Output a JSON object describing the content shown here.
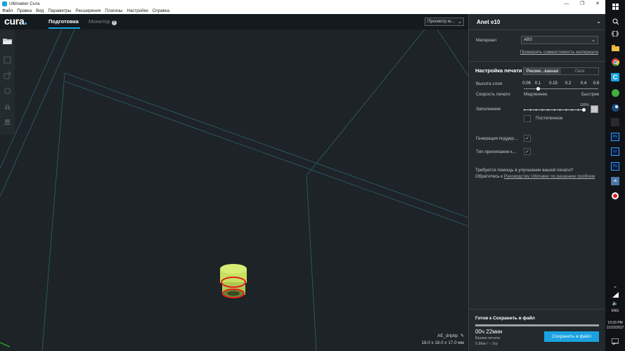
{
  "window": {
    "title": "Ultimaker Cura",
    "controls": {
      "minimize": "—",
      "maximize": "❐",
      "close": "✕"
    }
  },
  "menu": [
    "Файл",
    "Правка",
    "Вид",
    "Параметры",
    "Расширения",
    "Плагины",
    "Настройки",
    "Справка"
  ],
  "header": {
    "logo": "cura",
    "tabs": {
      "prepare": "Подготовка",
      "monitor": "Монитор",
      "monitor_help": "?"
    },
    "view_select": "Просмотр м..."
  },
  "toolbar": {
    "icons": [
      "open-folder-icon",
      "move-tool-icon",
      "scale-tool-icon",
      "rotate-tool-icon",
      "mirror-tool-icon",
      "support-blocker-icon"
    ]
  },
  "viewport": {
    "object_name": "AE_driptip",
    "object_size": "18.0 x 18.0 x 17.0 мм",
    "edit_icon": "pencil-icon"
  },
  "sidebar": {
    "printer_name": "Anet e10",
    "material_label": "Материал",
    "material_value": "ABS",
    "compat_link": "Проверить совместимость материала",
    "print_setup_title": "Настройка печати",
    "mode_recommended": "Рекоме...ванная",
    "mode_custom": "Своя",
    "layer_height_label": "Высота слоя",
    "layer_height_ticks": [
      "0.06",
      "0.1",
      "0.15",
      "0.2",
      "0.4",
      "0.6"
    ],
    "layer_height_selected": "0.1",
    "speed_label": "Скорость печати",
    "speed_slow": "Медленнее",
    "speed_fast": "Быстрее",
    "infill_label": "Заполнение",
    "infill_percent": "100%",
    "infill_value": 1.0,
    "gradual_label": "Постепенное",
    "support_label": "Генерация поддер...",
    "support_checked": "✓",
    "adhesion_label": "Тип прилипания к...",
    "adhesion_checked": "✓",
    "help_line1": "Требуется помощь в улучшении вашей печати?",
    "help_line2_prefix": "Обратитесь к ",
    "help_link": "Руководству Ultimaker по решению проблем",
    "status_title": "Готов к Сохранить в файл",
    "progress": 1.0,
    "print_time": "00ч 22мин",
    "print_time_label": "Время печати",
    "material_usage": "0.86м / ~ 2гр",
    "save_button": "Сохранить в файл"
  },
  "taskbar": {
    "language": "ENG",
    "time": "10:33 PM",
    "date": "11/22/2017"
  },
  "colors": {
    "accent": "#1aa3e0",
    "object_body": "#c8e060",
    "object_outline": "#e02020"
  }
}
